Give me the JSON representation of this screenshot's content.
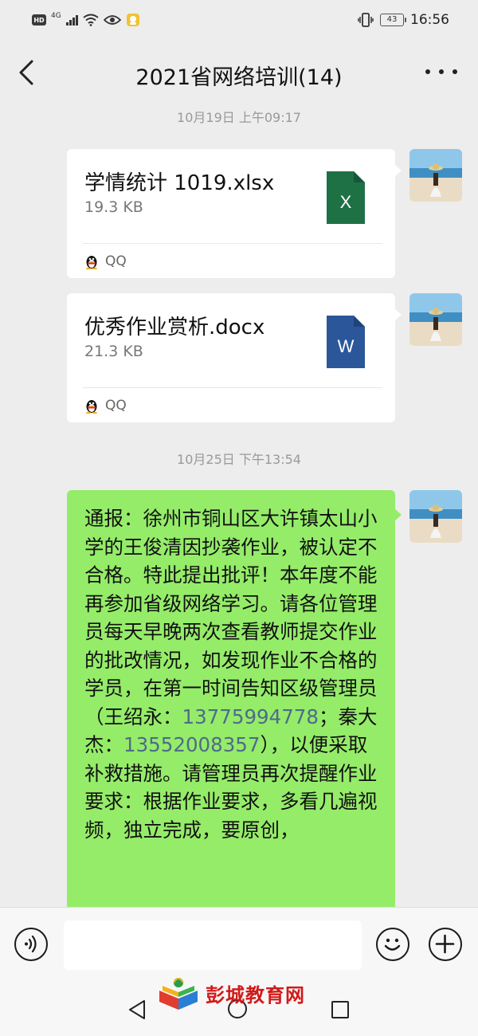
{
  "status_bar": {
    "hd": "HD",
    "network": "4G",
    "battery": "43",
    "time": "16:56"
  },
  "header": {
    "title": "2021省网络培训(14)"
  },
  "messages": {
    "timestamp_1": "10月19日 上午09:17",
    "file_1": {
      "name": "学情统计 1019.xlsx",
      "size": "19.3 KB",
      "icon_letter": "X",
      "icon_color": "#1e7145",
      "source": "QQ"
    },
    "file_2": {
      "name": "优秀作业赏析.docx",
      "size": "21.3 KB",
      "icon_letter": "W",
      "icon_color": "#2b579a",
      "source": "QQ"
    },
    "timestamp_2": "10月25日 下午13:54",
    "text": {
      "part1": "通报：徐州市铜山区大许镇太山小学的王俊清因抄袭作业，被认定不合格。特此提出批评！本年度不能再参加省级网络学习。请各位管理员每天早晚两次查看教师提交作业的批改情况，如发现作业不合格的学员，在第一时间告知区级管理员（王绍永：",
      "phone1": "13775994778",
      "part2": "；秦大杰：",
      "phone2": "13552008357",
      "part3": "），以便采取补救措施。请管理员再次提醒作业要求：根据作业要求，多看几遍视频，独立完成，要原创，"
    }
  },
  "input": {
    "placeholder": ""
  },
  "watermark": {
    "text": "彭城教育网"
  },
  "colors": {
    "bubble_green": "#95ec69",
    "link_blue": "#4e6b8a",
    "background": "#ededed"
  }
}
